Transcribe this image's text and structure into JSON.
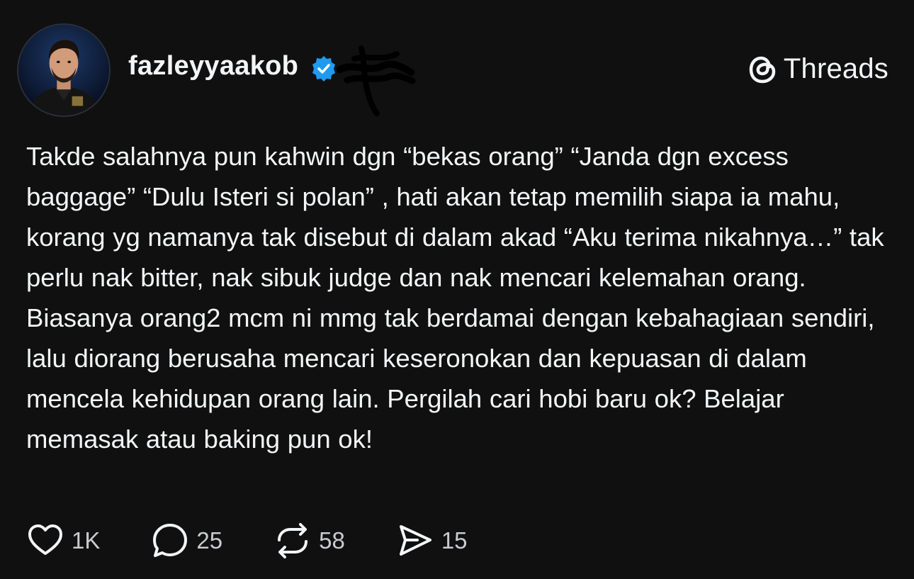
{
  "post": {
    "username": "fazleyyaakob",
    "brand_label": "Threads",
    "text": "Takde salahnya pun kahwin dgn “bekas orang” “Janda dgn excess baggage” “Dulu Isteri si polan” , hati akan tetap memilih siapa ia mahu, korang yg namanya tak disebut di dalam akad “Aku terima nikahnya…” tak perlu nak bitter, nak sibuk judge dan nak mencari kelemahan orang. Biasanya orang2 mcm ni mmg tak berdamai dengan kebahagiaan sendiri, lalu diorang berusaha mencari keseronokan dan kepuasan di dalam mencela kehidupan orang lain. Pergilah cari hobi baru ok? Belajar memasak atau baking pun ok!",
    "stats": {
      "likes": "1K",
      "replies": "25",
      "reposts": "58",
      "shares": "15"
    }
  },
  "icons": {
    "avatar": "profile-photo",
    "verified": "verified-badge-icon",
    "brand": "threads-logo-icon",
    "like": "heart-icon",
    "reply": "speech-bubble-icon",
    "repost": "repost-icon",
    "share": "send-icon"
  },
  "colors": {
    "background": "#101010",
    "text": "#f3f5f7",
    "secondary_text": "#c9cbcf",
    "verified": "#1d9bf0"
  }
}
